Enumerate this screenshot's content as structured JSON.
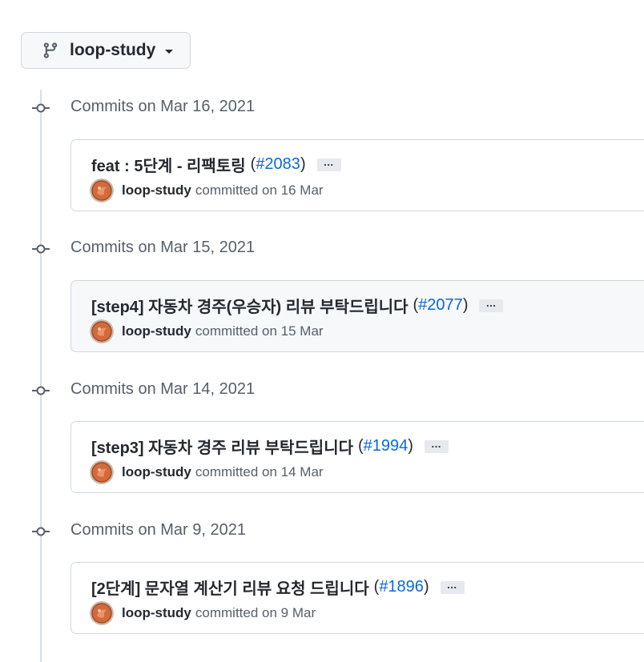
{
  "branch": {
    "name": "loop-study",
    "icon": "git-branch-icon"
  },
  "groups": [
    {
      "date_label": "Commits on Mar 16, 2021",
      "commit": {
        "message": "feat : 5단계 - 리팩토링",
        "pr_open": "(",
        "pr": "#2083",
        "pr_close": ")",
        "ellipsis": "…",
        "author": "loop-study",
        "committed_text": "committed on 16 Mar"
      }
    },
    {
      "date_label": "Commits on Mar 15, 2021",
      "commit": {
        "message": "[step4] 자동차 경주(우승자) 리뷰 부탁드립니다",
        "pr_open": "(",
        "pr": "#2077",
        "pr_close": ")",
        "ellipsis": "…",
        "author": "loop-study",
        "committed_text": "committed on 15 Mar"
      }
    },
    {
      "date_label": "Commits on Mar 14, 2021",
      "commit": {
        "message": "[step3] 자동차 경주 리뷰 부탁드립니다",
        "pr_open": "(",
        "pr": "#1994",
        "pr_close": ")",
        "ellipsis": "…",
        "author": "loop-study",
        "committed_text": "committed on 14 Mar"
      }
    },
    {
      "date_label": "Commits on Mar 9, 2021",
      "commit": {
        "message": "[2단계] 문자열 계산기 리뷰 요청 드립니다",
        "pr_open": "(",
        "pr": "#1896",
        "pr_close": ")",
        "ellipsis": "…",
        "author": "loop-study",
        "committed_text": "committed on 9 Mar"
      }
    }
  ],
  "colors": {
    "link": "#0969da",
    "muted": "#57606a",
    "border": "#d0d7de"
  }
}
